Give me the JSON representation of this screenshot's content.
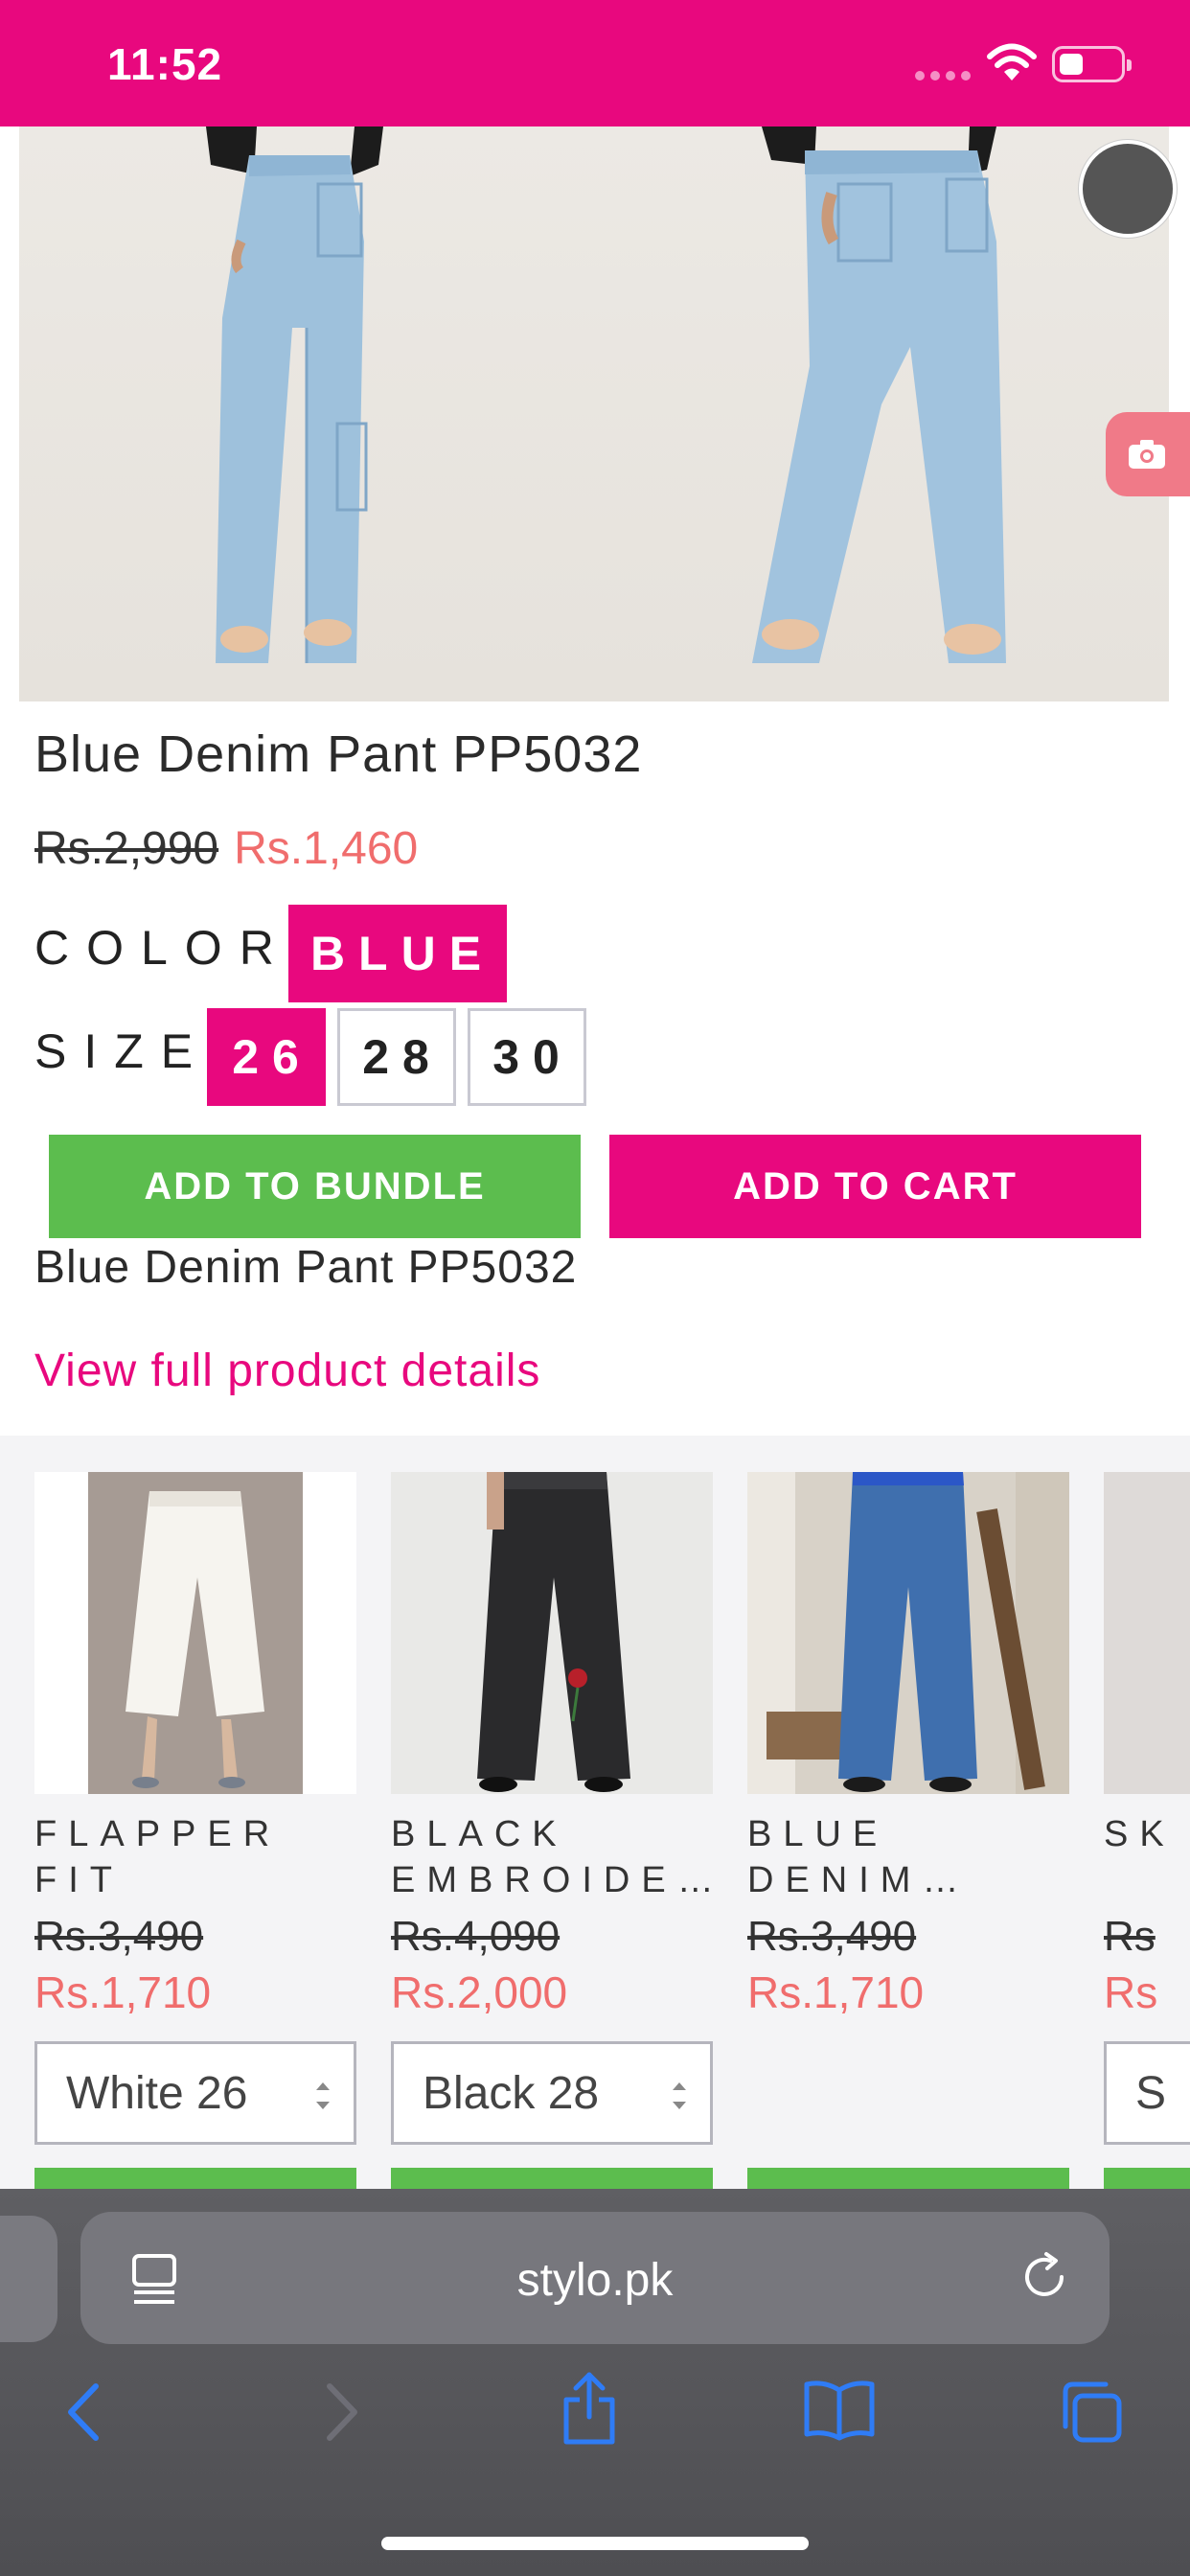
{
  "status_bar": {
    "time": "11:52",
    "icons": [
      "signal-dots-icon",
      "wifi-icon",
      "battery-icon"
    ],
    "background": "#e8087e"
  },
  "gallery": {
    "images": [
      {
        "subject": "jeans-front-view"
      },
      {
        "subject": "jeans-angled-view"
      }
    ]
  },
  "product": {
    "title": "Blue Denim Pant PP5032",
    "price_old": "Rs.2,990",
    "price_new": "Rs.1,460",
    "color_label": "COLOR",
    "color_value": "BLUE",
    "size_label": "SIZE",
    "sizes": [
      "26",
      "28",
      "30"
    ],
    "selected_size": "26",
    "add_to_bundle": "ADD TO BUNDLE",
    "add_to_cart": "ADD TO CART",
    "sub_title": "Blue Denim Pant PP5032",
    "details_link": "View full product details"
  },
  "related": [
    {
      "name": "FLAPPER FIT DENIM…",
      "price_old": "Rs.3,490",
      "price_new": "Rs.1,710",
      "select": "White 26"
    },
    {
      "name": "BLACK EMBROIDE…",
      "price_old": "Rs.4,090",
      "price_new": "Rs.2,000",
      "select": "Black 28"
    },
    {
      "name": "BLUE DENIM…",
      "price_old": "Rs.3,490",
      "price_new": "Rs.1,710",
      "select": ""
    },
    {
      "name": "SK W",
      "price_old": "Rs",
      "price_new": "Rs",
      "select": "S"
    }
  ],
  "browser": {
    "url": "stylo.pk",
    "icons": [
      "reader-icon",
      "reload-icon",
      "back-icon",
      "forward-icon",
      "share-icon",
      "bookmarks-icon",
      "tabs-icon"
    ]
  },
  "colors": {
    "brand_pink": "#e8087e",
    "sale_red": "#f06d6d",
    "green": "#5cbd4e",
    "ios_blue": "#2f7cf6"
  }
}
